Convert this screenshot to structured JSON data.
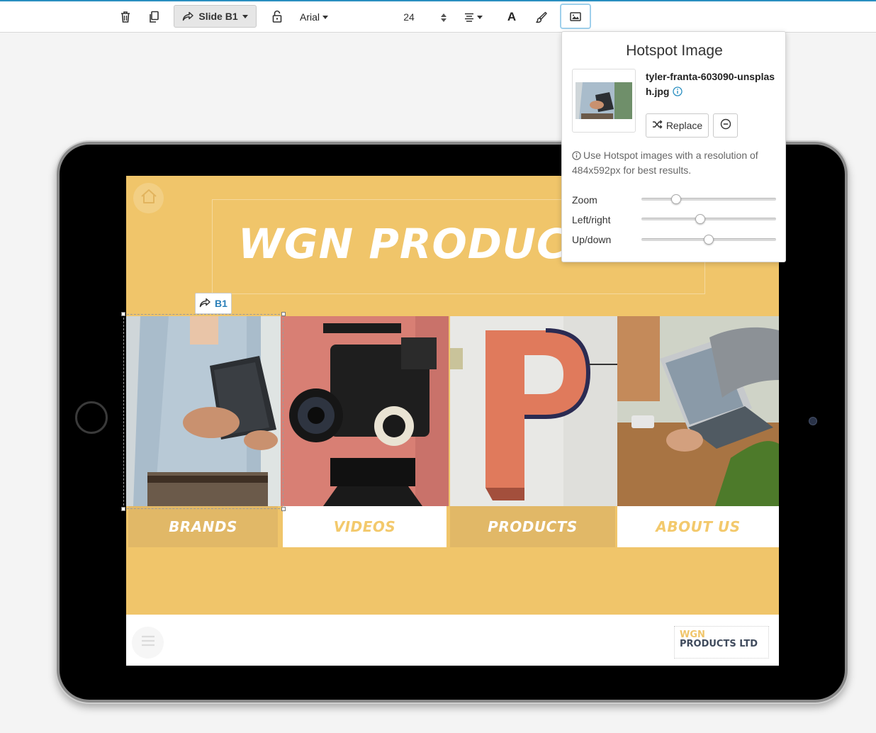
{
  "toolbar": {
    "slide_label": "Slide B1",
    "font": "Arial",
    "font_size": "24",
    "text_color_glyph": "A",
    "icons": [
      "trash-icon",
      "duplicate-icon",
      "link-arrow-icon",
      "unlock-icon",
      "align-icon",
      "brush-icon",
      "image-icon"
    ]
  },
  "slide": {
    "title": "WGN PRODUCTS LTD",
    "tiles": [
      {
        "label": "BRANDS",
        "style": "filled"
      },
      {
        "label": "VIDEOS",
        "style": "white"
      },
      {
        "label": "PRODUCTS",
        "style": "filled"
      },
      {
        "label": "ABOUT US",
        "style": "white"
      }
    ],
    "logo_line1": "WGN",
    "logo_line2": "PRODUCTS LTD",
    "background_color": "#f0c56a"
  },
  "hotspot_badge": {
    "label": "B1"
  },
  "popover": {
    "title": "Hotspot Image",
    "file_name": "tyler-franta-603090-unsplash.jpg",
    "replace_label": "Replace",
    "hint": "Use Hotspot images with a resolution of 484x592px for best results.",
    "sliders": [
      {
        "label": "Zoom",
        "value": 0.24
      },
      {
        "label": "Left/right",
        "value": 0.43
      },
      {
        "label": "Up/down",
        "value": 0.5
      }
    ]
  },
  "colors": {
    "accent": "#2a8fc0",
    "tile_label_filled": "#e1b867",
    "tile_label_text_white": "#f3c96c",
    "logo_dark": "#3f4a5c"
  }
}
